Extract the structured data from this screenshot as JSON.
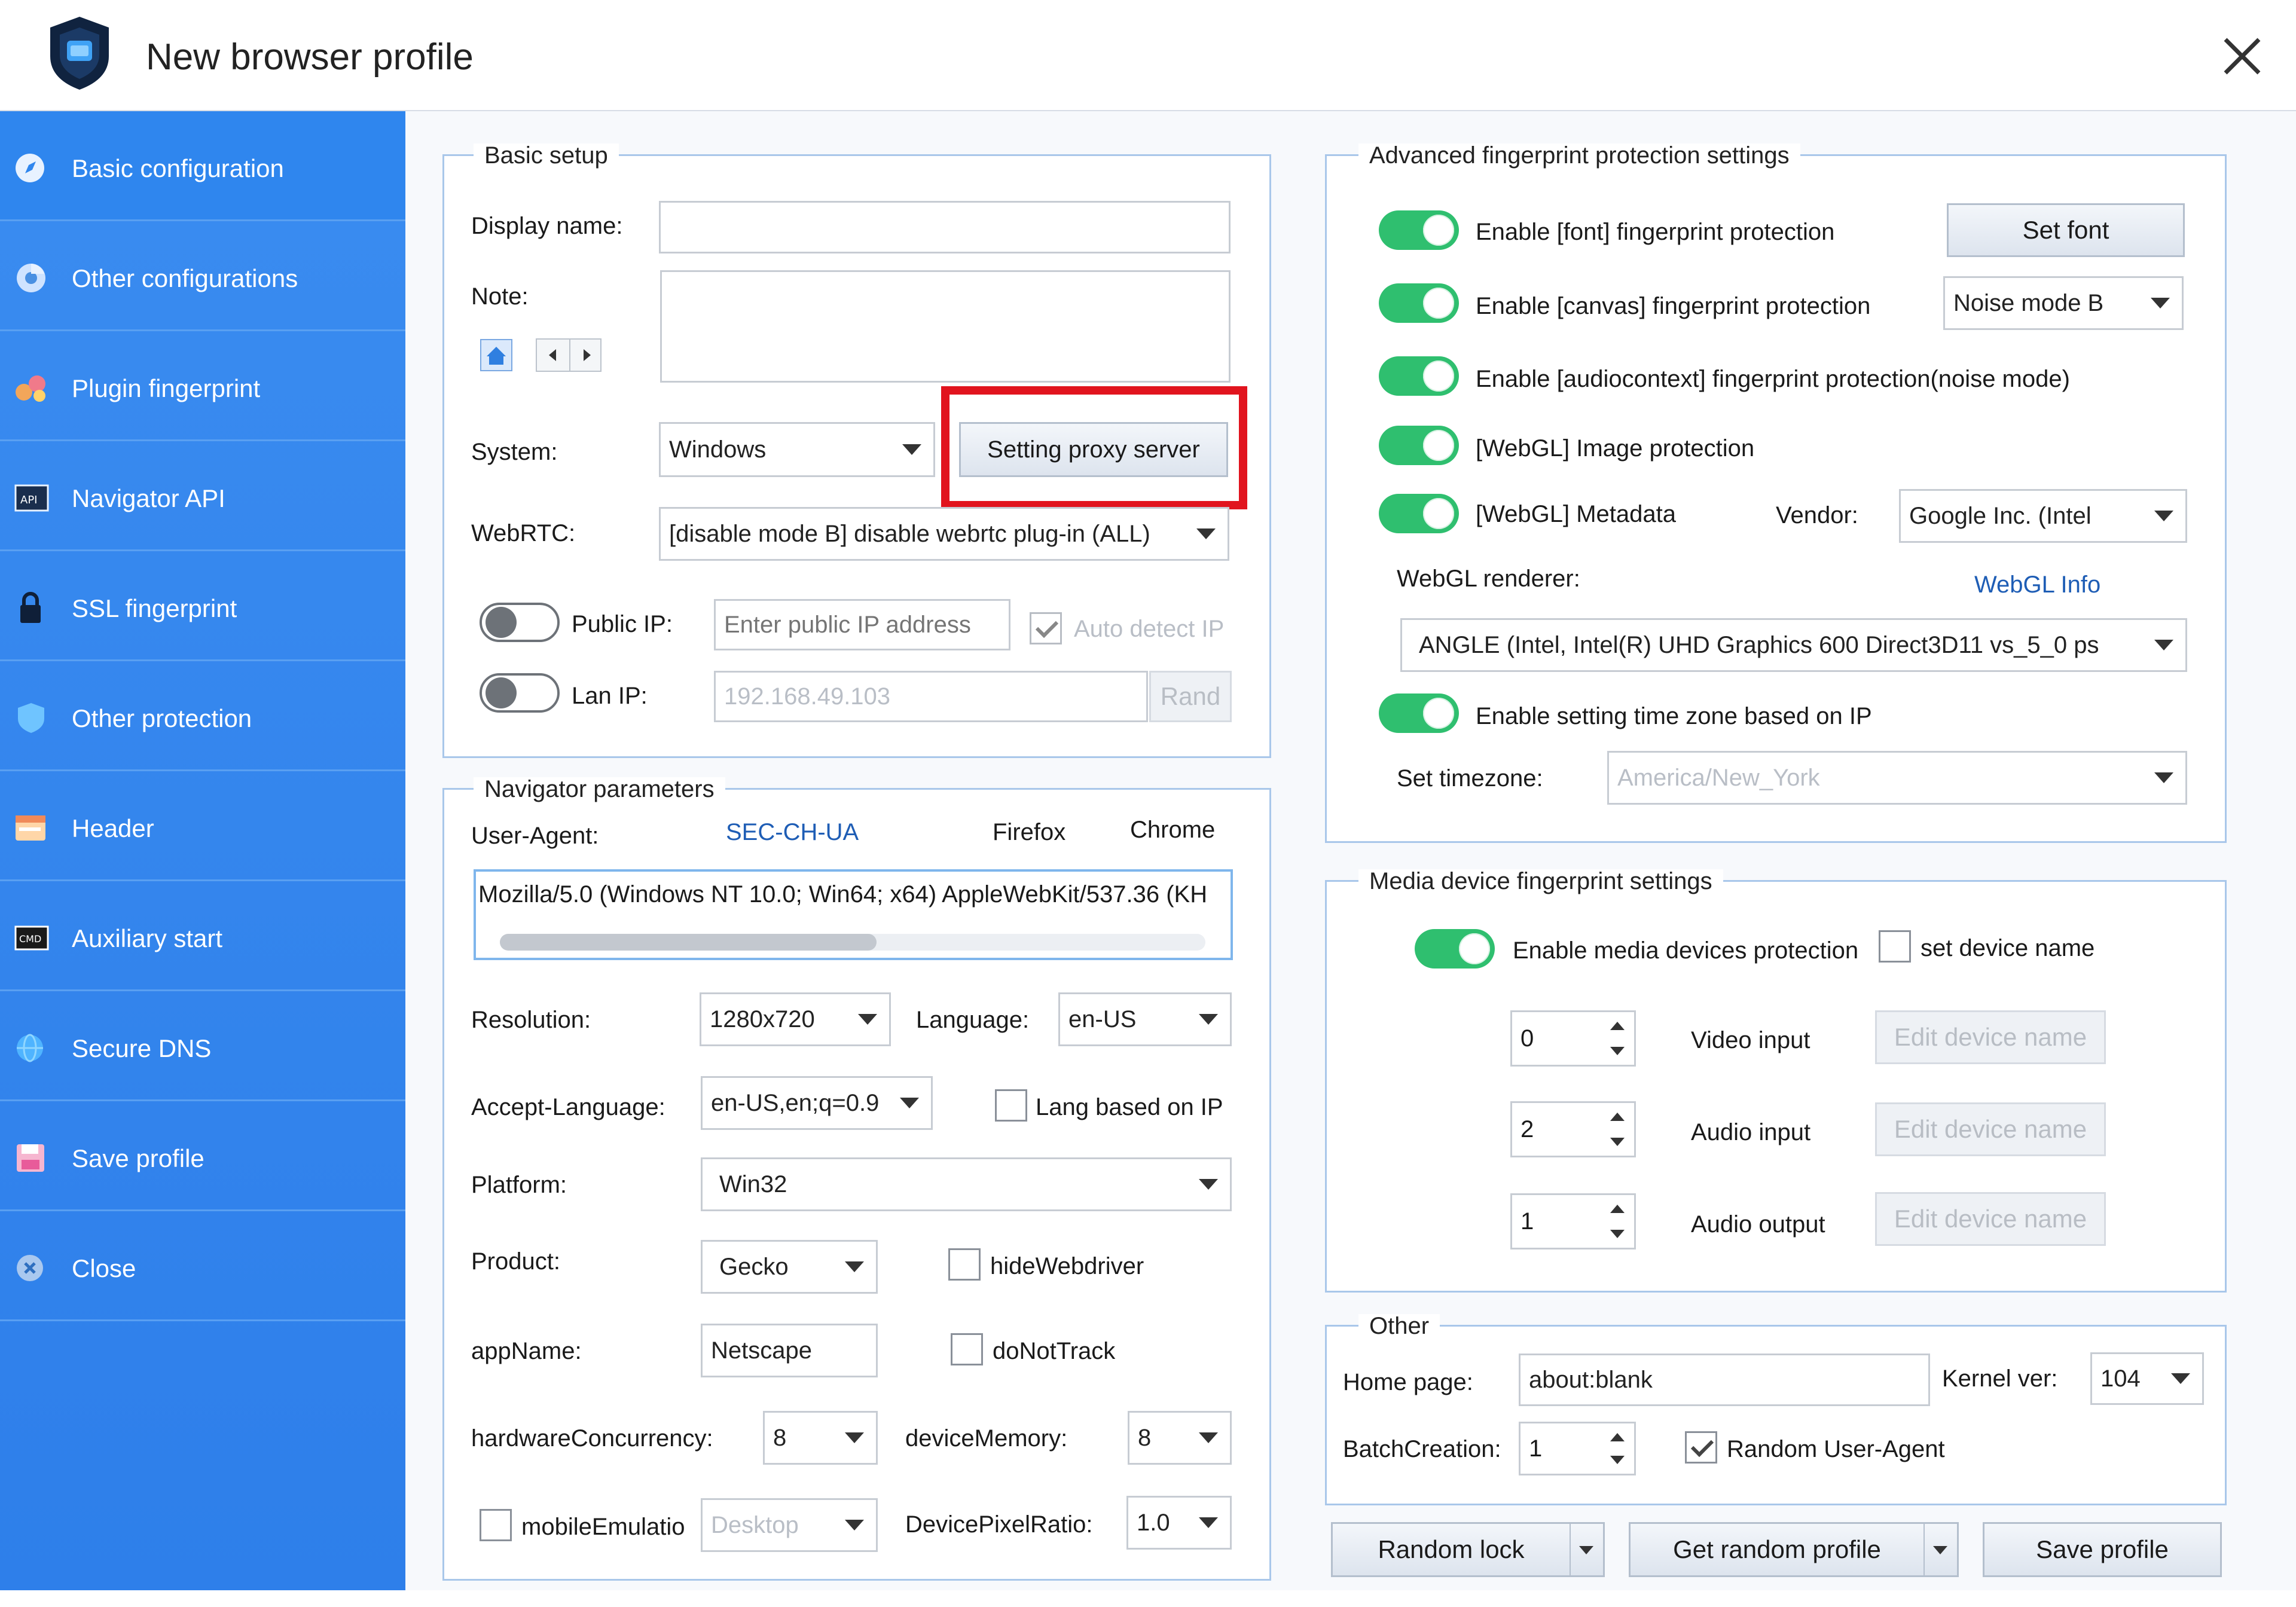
{
  "window": {
    "title": "New browser profile"
  },
  "sidebar": {
    "items": [
      {
        "label": "Basic configuration",
        "icon": "compass-icon"
      },
      {
        "label": "Other configurations",
        "icon": "chrome-icon"
      },
      {
        "label": "Plugin fingerprint",
        "icon": "puzzle-icon"
      },
      {
        "label": "Navigator API",
        "icon": "api-icon"
      },
      {
        "label": "SSL fingerprint",
        "icon": "lock-icon"
      },
      {
        "label": "Other protection",
        "icon": "shield-icon"
      },
      {
        "label": "Header",
        "icon": "header-icon"
      },
      {
        "label": "Auxiliary start",
        "icon": "cmd-icon"
      },
      {
        "label": "Secure DNS",
        "icon": "globe-icon"
      },
      {
        "label": "Save profile",
        "icon": "save-icon"
      },
      {
        "label": "Close",
        "icon": "close-circle-icon"
      }
    ]
  },
  "basic_setup": {
    "title": "Basic setup",
    "display_name_label": "Display name:",
    "display_name_value": "",
    "note_label": "Note:",
    "note_value": "",
    "system_label": "System:",
    "system_value": "Windows",
    "proxy_button": "Setting proxy server",
    "webrtc_label": "WebRTC:",
    "webrtc_value": "[disable mode B] disable webrtc plug-in (ALL)",
    "public_ip_label": "Public IP:",
    "public_ip_placeholder": "Enter public IP address",
    "auto_detect_label": "Auto detect IP",
    "lan_ip_label": "Lan IP:",
    "lan_ip_value": "192.168.49.103",
    "rand_button": "Rand"
  },
  "navigator": {
    "title": "Navigator parameters",
    "ua_label": "User-Agent:",
    "sec_ch_ua": "SEC-CH-UA",
    "firefox": "Firefox",
    "chrome": "Chrome",
    "ua_value": "Mozilla/5.0 (Windows NT 10.0; Win64; x64) AppleWebKit/537.36 (KH",
    "resolution_label": "Resolution:",
    "resolution_value": "1280x720",
    "language_label": "Language:",
    "language_value": "en-US",
    "accept_language_label": "Accept-Language:",
    "accept_language_value": "en-US,en;q=0.9",
    "lang_based_ip": "Lang based on IP",
    "platform_label": "Platform:",
    "platform_value": "Win32",
    "product_label": "Product:",
    "product_value": "Gecko",
    "hide_webdriver": "hideWebdriver",
    "appname_label": "appName:",
    "appname_value": "Netscape",
    "do_not_track": "doNotTrack",
    "hw_label": "hardwareConcurrency:",
    "hw_value": "8",
    "device_memory_label": "deviceMemory:",
    "device_memory_value": "8",
    "mobile_emulation": "mobileEmulatio",
    "mobile_value": "Desktop",
    "dpr_label": "DevicePixelRatio:",
    "dpr_value": "1.0"
  },
  "advanced": {
    "title": "Advanced fingerprint protection settings",
    "font_label": "Enable [font] fingerprint protection",
    "set_font_button": "Set font",
    "canvas_label": "Enable [canvas] fingerprint protection",
    "canvas_mode": "Noise mode B",
    "audio_label": "Enable [audiocontext] fingerprint  protection(noise mode)",
    "webgl_image_label": "[WebGL] Image protection",
    "webgl_meta_label": "[WebGL] Metadata",
    "vendor_label": "Vendor:",
    "vendor_value": "Google Inc. (Intel",
    "renderer_label": "WebGL renderer:",
    "webgl_info_link": "WebGL Info",
    "renderer_value": "ANGLE (Intel, Intel(R) UHD Graphics 600 Direct3D11 vs_5_0 ps",
    "timezone_toggle_label": "Enable setting time zone based on IP",
    "set_timezone_label": "Set timezone:",
    "timezone_value": "America/New_York"
  },
  "media": {
    "title": "Media device fingerprint settings",
    "enable_label": "Enable media devices protection",
    "set_device_name": "set device name",
    "video_value": "0",
    "video_label": "Video input",
    "audio_in_value": "2",
    "audio_in_label": "Audio input",
    "audio_out_value": "1",
    "audio_out_label": "Audio output",
    "edit_device_name": "Edit device name"
  },
  "other": {
    "title": "Other",
    "home_label": "Home page:",
    "home_value": "about:blank",
    "kernel_label": "Kernel ver:",
    "kernel_value": "104",
    "batch_label": "BatchCreation:",
    "batch_value": "1",
    "random_ua_label": "Random User-Agent"
  },
  "footer": {
    "random_lock": "Random lock",
    "get_random_profile": "Get random profile",
    "save_profile": "Save profile"
  },
  "colors": {
    "sidebar": "#2e7fea",
    "toggle_on": "#2fbf6f",
    "highlight": "#e1141e",
    "link": "#1e5db5"
  }
}
